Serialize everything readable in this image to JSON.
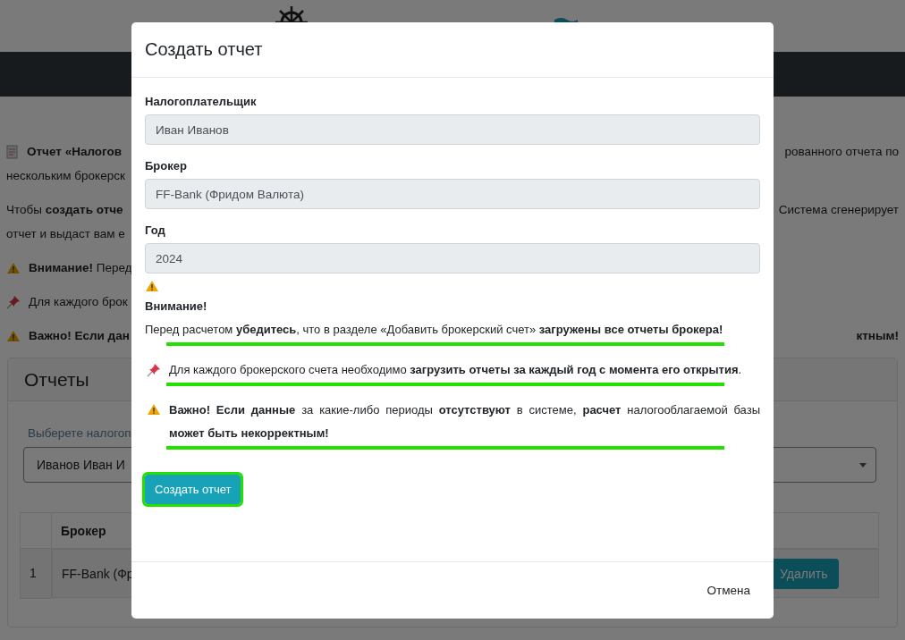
{
  "background": {
    "paragraphs": [
      {
        "lines": [
          {
            "kind": "document",
            "text": "**Отчет «Налогов**",
            "right": "рованного отчета по"
          },
          {
            "text": "нескольким брокерск"
          }
        ]
      },
      {
        "lines": [
          {
            "text": "Чтобы **создать отче**",
            "right": "Система сгенерирует"
          },
          {
            "text": "отчет и выдаст вам е"
          }
        ]
      },
      {
        "lines": [
          {
            "kind": "warning",
            "text": "**Внимание!** Перед"
          }
        ]
      },
      {
        "lines": [
          {
            "kind": "pin",
            "text": "Для каждого брок"
          }
        ]
      },
      {
        "lines": [
          {
            "kind": "warning",
            "text": "**Важно! Если дан**",
            "right": "**ктным!**"
          }
        ]
      }
    ],
    "reports_card": {
      "title": "Отчеты",
      "select_label": "Выберете налогоп",
      "select_value": "Иванов Иван И",
      "columns": [
        "Брокер"
      ],
      "rows": [
        {
          "number": "1",
          "broker": "FF-Bank (Фр",
          "action": "Удалить"
        }
      ]
    }
  },
  "modal": {
    "title": "Создать отчет",
    "fields": [
      {
        "label": "Налогоплательщик",
        "value": "Иван Иванов",
        "disabled": true
      },
      {
        "label": "Брокер",
        "value": "FF-Bank (Фридом Валюта)",
        "disabled": true
      },
      {
        "label": "Год",
        "value": "2024",
        "disabled": true
      }
    ],
    "notices": [
      {
        "kind": "warning",
        "heading": "Внимание!",
        "text": "Перед расчетом **убедитесь**, что в разделе «Добавить брокерский счет» **загружены все отчеты брокера!**",
        "underlined": true
      },
      {
        "kind": "pin",
        "text": "Для каждого брокерского счета необходимо **загрузить отчеты за каждый год с момента его открытия**.",
        "underlined": true
      },
      {
        "kind": "warning",
        "text": "**Важно! Если данные** за какие-либо периоды **отсутствуют** в системе, **расчет** налогооблагаемой базы **может быть некорректным!**",
        "underlined": true
      }
    ],
    "submit": {
      "label": "Создать отчет",
      "highlighted": true
    },
    "cancel": "Отмена"
  }
}
